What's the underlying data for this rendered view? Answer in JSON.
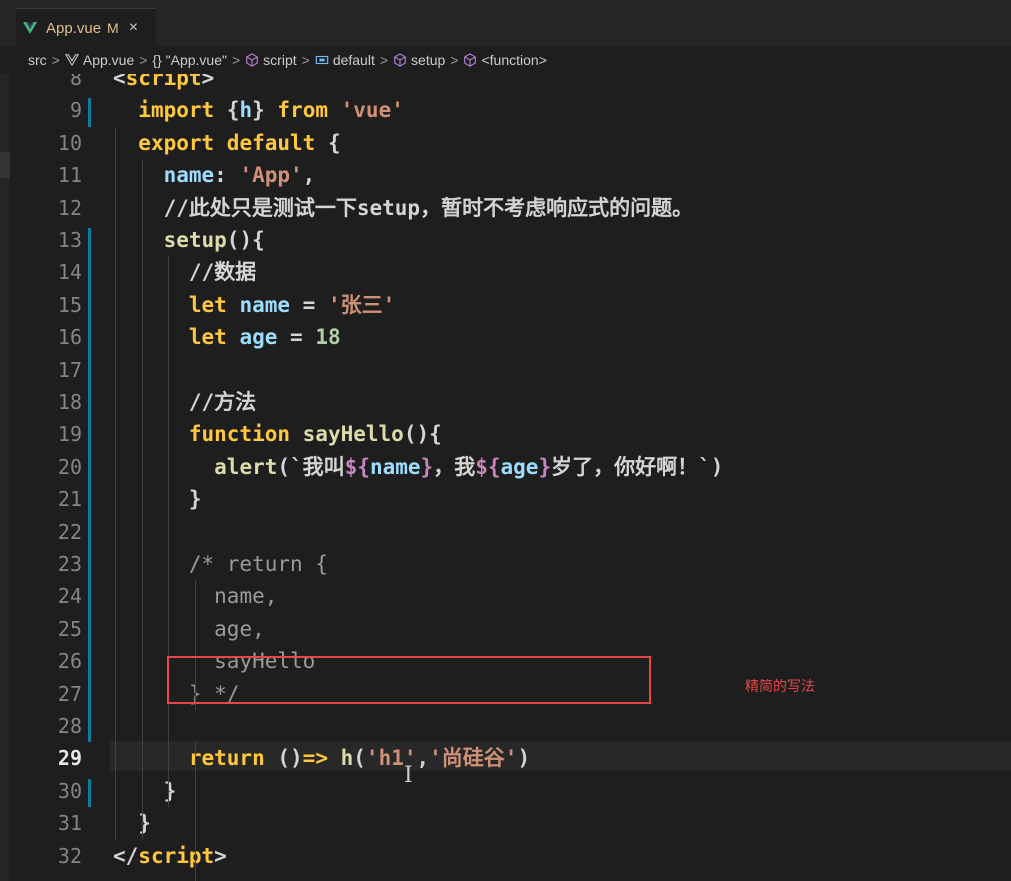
{
  "tab": {
    "label": "App.vue",
    "modified": "M",
    "close": "×",
    "icon": "vue-icon"
  },
  "breadcrumb": [
    {
      "text": "src",
      "icon": ""
    },
    {
      "text": "App.vue",
      "icon": "vue-icon"
    },
    {
      "text": "{} \"App.vue\"",
      "icon": ""
    },
    {
      "text": "script",
      "icon": "cube-icon"
    },
    {
      "text": "default",
      "icon": "field-icon"
    },
    {
      "text": "setup",
      "icon": "cube-icon"
    },
    {
      "text": "<function>",
      "icon": "cube-icon"
    }
  ],
  "lines": [
    {
      "n": "8",
      "parts": [
        [
          "tagc",
          "<"
        ],
        [
          "kw",
          "script"
        ],
        [
          "tagc",
          ">"
        ]
      ]
    },
    {
      "n": "9",
      "parts": [
        [
          "pn",
          "  "
        ],
        [
          "kw",
          "import "
        ],
        [
          "pn",
          "{"
        ],
        [
          "prop",
          "h"
        ],
        [
          "pn",
          "} "
        ],
        [
          "kw",
          "from "
        ],
        [
          "str",
          "'vue'"
        ]
      ]
    },
    {
      "n": "10",
      "parts": [
        [
          "pn",
          "  "
        ],
        [
          "kw",
          "export default "
        ],
        [
          "pn",
          "{"
        ]
      ]
    },
    {
      "n": "11",
      "parts": [
        [
          "pn",
          "    "
        ],
        [
          "prop",
          "name"
        ],
        [
          "pn",
          ": "
        ],
        [
          "str",
          "'App'"
        ],
        [
          "pn",
          ","
        ]
      ]
    },
    {
      "n": "12",
      "parts": [
        [
          "pn",
          "    "
        ],
        [
          "pn",
          "//此处只是测试一下setup，暂时不考虑响应式的问题。"
        ]
      ]
    },
    {
      "n": "13",
      "parts": [
        [
          "pn",
          "    "
        ],
        [
          "fn",
          "setup"
        ],
        [
          "pn",
          "(){"
        ]
      ]
    },
    {
      "n": "14",
      "parts": [
        [
          "pn",
          "      "
        ],
        [
          "pn",
          "//数据"
        ]
      ]
    },
    {
      "n": "15",
      "parts": [
        [
          "pn",
          "      "
        ],
        [
          "kw",
          "let "
        ],
        [
          "prop",
          "name"
        ],
        [
          "pn",
          " = "
        ],
        [
          "str",
          "'张三'"
        ]
      ]
    },
    {
      "n": "16",
      "parts": [
        [
          "pn",
          "      "
        ],
        [
          "kw",
          "let "
        ],
        [
          "prop",
          "age"
        ],
        [
          "pn",
          " = "
        ],
        [
          "num",
          "18"
        ]
      ]
    },
    {
      "n": "17",
      "parts": []
    },
    {
      "n": "18",
      "parts": [
        [
          "pn",
          "      "
        ],
        [
          "pn",
          "//方法"
        ]
      ]
    },
    {
      "n": "19",
      "parts": [
        [
          "pn",
          "      "
        ],
        [
          "kw",
          "function "
        ],
        [
          "fn",
          "sayHello"
        ],
        [
          "pn",
          "(){"
        ]
      ]
    },
    {
      "n": "20",
      "parts": [
        [
          "pn",
          "        "
        ],
        [
          "fn",
          "alert"
        ],
        [
          "pn",
          "(`"
        ],
        [
          "pn",
          "我叫"
        ],
        [
          "tmpl",
          "${"
        ],
        [
          "prop",
          "name"
        ],
        [
          "tmpl",
          "}"
        ],
        [
          "pn",
          "，我"
        ],
        [
          "tmpl",
          "${"
        ],
        [
          "prop",
          "age"
        ],
        [
          "tmpl",
          "}"
        ],
        [
          "pn",
          "岁了，你好啊！`)"
        ]
      ]
    },
    {
      "n": "21",
      "parts": [
        [
          "pn",
          "      }"
        ]
      ]
    },
    {
      "n": "22",
      "parts": []
    },
    {
      "n": "23",
      "parts": [
        [
          "pn",
          "      "
        ],
        [
          "cm",
          "/* return {"
        ]
      ]
    },
    {
      "n": "24",
      "parts": [
        [
          "pn",
          "        "
        ],
        [
          "cm",
          "name,"
        ]
      ]
    },
    {
      "n": "25",
      "parts": [
        [
          "pn",
          "        "
        ],
        [
          "cm",
          "age,"
        ]
      ]
    },
    {
      "n": "26",
      "parts": [
        [
          "pn",
          "        "
        ],
        [
          "cm",
          "sayHello"
        ]
      ]
    },
    {
      "n": "27",
      "parts": [
        [
          "pn",
          "      "
        ],
        [
          "cm",
          "} */"
        ]
      ]
    },
    {
      "n": "28",
      "parts": []
    },
    {
      "n": "29",
      "parts": [
        [
          "pn",
          "      "
        ],
        [
          "kw",
          "return "
        ],
        [
          "pn",
          "()"
        ],
        [
          "kw",
          "=> "
        ],
        [
          "fn",
          "h"
        ],
        [
          "pn",
          "("
        ],
        [
          "str",
          "'h1'"
        ],
        [
          "pn",
          ","
        ],
        [
          "str",
          "'尚硅谷'"
        ],
        [
          "pn",
          ")"
        ]
      ]
    },
    {
      "n": "30",
      "parts": [
        [
          "pn",
          "    }"
        ]
      ]
    },
    {
      "n": "31",
      "parts": [
        [
          "pn",
          "  }"
        ]
      ]
    },
    {
      "n": "32",
      "parts": [
        [
          "tagc",
          "</"
        ],
        [
          "kw",
          "script"
        ],
        [
          "tagc",
          ">"
        ]
      ]
    }
  ],
  "active_line": "29",
  "annotation": "精简的写法",
  "colors": {
    "keyword": "#ffc83d",
    "string": "#ce9178",
    "property": "#9cdcfe",
    "function": "#dcdcaa",
    "comment": "#9a9a9a",
    "highlight": "#e8474a"
  }
}
